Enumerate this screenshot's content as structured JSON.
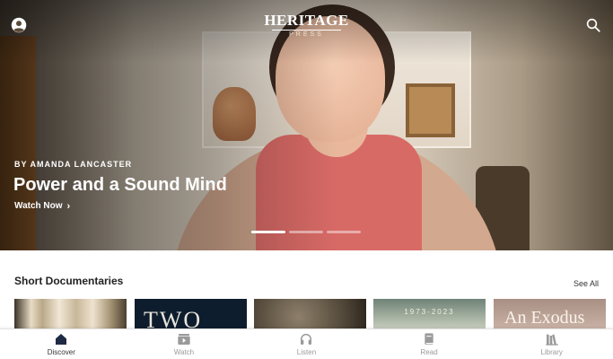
{
  "app": {
    "logo_main": "HERITAGE",
    "logo_sub": "PRESS"
  },
  "hero": {
    "byline": "BY AMANDA LANCASTER",
    "title": "Power and a Sound Mind",
    "cta": "Watch Now",
    "slides_total": 3,
    "active_slide": 1
  },
  "section": {
    "title": "Short Documentaries",
    "see_all": "See All",
    "thumbnails": [
      {
        "caption": ""
      },
      {
        "caption": "TWO"
      },
      {
        "caption": ""
      },
      {
        "caption": "1973-2023"
      },
      {
        "caption": "An Exodus"
      }
    ]
  },
  "nav": {
    "items": [
      {
        "label": "Discover",
        "icon": "home-icon",
        "active": true
      },
      {
        "label": "Watch",
        "icon": "play-icon",
        "active": false
      },
      {
        "label": "Listen",
        "icon": "headphones-icon",
        "active": false
      },
      {
        "label": "Read",
        "icon": "book-icon",
        "active": false
      },
      {
        "label": "Library",
        "icon": "library-icon",
        "active": false
      }
    ]
  },
  "colors": {
    "nav_active": "#333333",
    "nav_inactive": "#9a9a9a",
    "hero_text": "#ffffff"
  }
}
